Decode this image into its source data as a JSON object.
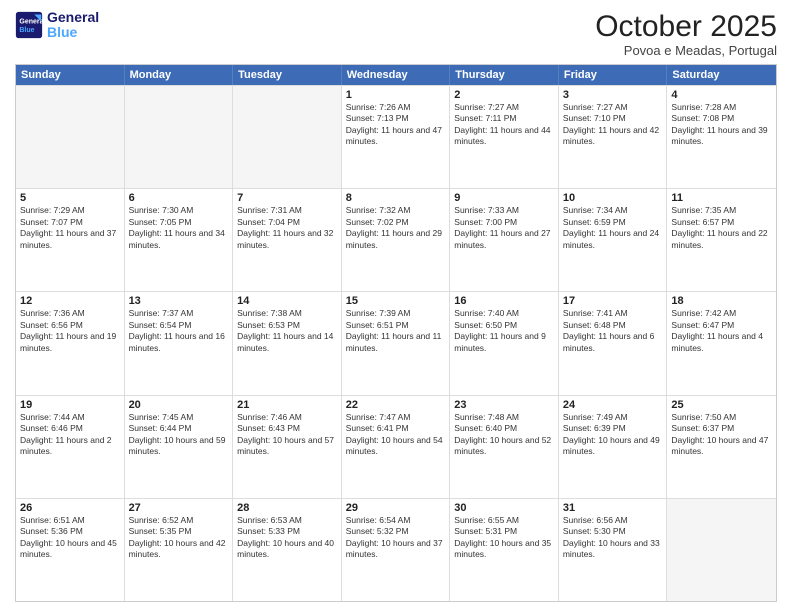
{
  "header": {
    "logo_line1": "General",
    "logo_line2": "Blue",
    "month_title": "October 2025",
    "location": "Povoa e Meadas, Portugal"
  },
  "days_of_week": [
    "Sunday",
    "Monday",
    "Tuesday",
    "Wednesday",
    "Thursday",
    "Friday",
    "Saturday"
  ],
  "rows": [
    [
      {
        "day": "",
        "empty": true
      },
      {
        "day": "",
        "empty": true
      },
      {
        "day": "",
        "empty": true
      },
      {
        "day": "1",
        "sunrise": "7:26 AM",
        "sunset": "7:13 PM",
        "daylight": "11 hours and 47 minutes."
      },
      {
        "day": "2",
        "sunrise": "7:27 AM",
        "sunset": "7:11 PM",
        "daylight": "11 hours and 44 minutes."
      },
      {
        "day": "3",
        "sunrise": "7:27 AM",
        "sunset": "7:10 PM",
        "daylight": "11 hours and 42 minutes."
      },
      {
        "day": "4",
        "sunrise": "7:28 AM",
        "sunset": "7:08 PM",
        "daylight": "11 hours and 39 minutes."
      }
    ],
    [
      {
        "day": "5",
        "sunrise": "7:29 AM",
        "sunset": "7:07 PM",
        "daylight": "11 hours and 37 minutes."
      },
      {
        "day": "6",
        "sunrise": "7:30 AM",
        "sunset": "7:05 PM",
        "daylight": "11 hours and 34 minutes."
      },
      {
        "day": "7",
        "sunrise": "7:31 AM",
        "sunset": "7:04 PM",
        "daylight": "11 hours and 32 minutes."
      },
      {
        "day": "8",
        "sunrise": "7:32 AM",
        "sunset": "7:02 PM",
        "daylight": "11 hours and 29 minutes."
      },
      {
        "day": "9",
        "sunrise": "7:33 AM",
        "sunset": "7:00 PM",
        "daylight": "11 hours and 27 minutes."
      },
      {
        "day": "10",
        "sunrise": "7:34 AM",
        "sunset": "6:59 PM",
        "daylight": "11 hours and 24 minutes."
      },
      {
        "day": "11",
        "sunrise": "7:35 AM",
        "sunset": "6:57 PM",
        "daylight": "11 hours and 22 minutes."
      }
    ],
    [
      {
        "day": "12",
        "sunrise": "7:36 AM",
        "sunset": "6:56 PM",
        "daylight": "11 hours and 19 minutes."
      },
      {
        "day": "13",
        "sunrise": "7:37 AM",
        "sunset": "6:54 PM",
        "daylight": "11 hours and 16 minutes."
      },
      {
        "day": "14",
        "sunrise": "7:38 AM",
        "sunset": "6:53 PM",
        "daylight": "11 hours and 14 minutes."
      },
      {
        "day": "15",
        "sunrise": "7:39 AM",
        "sunset": "6:51 PM",
        "daylight": "11 hours and 11 minutes."
      },
      {
        "day": "16",
        "sunrise": "7:40 AM",
        "sunset": "6:50 PM",
        "daylight": "11 hours and 9 minutes."
      },
      {
        "day": "17",
        "sunrise": "7:41 AM",
        "sunset": "6:48 PM",
        "daylight": "11 hours and 6 minutes."
      },
      {
        "day": "18",
        "sunrise": "7:42 AM",
        "sunset": "6:47 PM",
        "daylight": "11 hours and 4 minutes."
      }
    ],
    [
      {
        "day": "19",
        "sunrise": "7:44 AM",
        "sunset": "6:46 PM",
        "daylight": "11 hours and 2 minutes."
      },
      {
        "day": "20",
        "sunrise": "7:45 AM",
        "sunset": "6:44 PM",
        "daylight": "10 hours and 59 minutes."
      },
      {
        "day": "21",
        "sunrise": "7:46 AM",
        "sunset": "6:43 PM",
        "daylight": "10 hours and 57 minutes."
      },
      {
        "day": "22",
        "sunrise": "7:47 AM",
        "sunset": "6:41 PM",
        "daylight": "10 hours and 54 minutes."
      },
      {
        "day": "23",
        "sunrise": "7:48 AM",
        "sunset": "6:40 PM",
        "daylight": "10 hours and 52 minutes."
      },
      {
        "day": "24",
        "sunrise": "7:49 AM",
        "sunset": "6:39 PM",
        "daylight": "10 hours and 49 minutes."
      },
      {
        "day": "25",
        "sunrise": "7:50 AM",
        "sunset": "6:37 PM",
        "daylight": "10 hours and 47 minutes."
      }
    ],
    [
      {
        "day": "26",
        "sunrise": "6:51 AM",
        "sunset": "5:36 PM",
        "daylight": "10 hours and 45 minutes."
      },
      {
        "day": "27",
        "sunrise": "6:52 AM",
        "sunset": "5:35 PM",
        "daylight": "10 hours and 42 minutes."
      },
      {
        "day": "28",
        "sunrise": "6:53 AM",
        "sunset": "5:33 PM",
        "daylight": "10 hours and 40 minutes."
      },
      {
        "day": "29",
        "sunrise": "6:54 AM",
        "sunset": "5:32 PM",
        "daylight": "10 hours and 37 minutes."
      },
      {
        "day": "30",
        "sunrise": "6:55 AM",
        "sunset": "5:31 PM",
        "daylight": "10 hours and 35 minutes."
      },
      {
        "day": "31",
        "sunrise": "6:56 AM",
        "sunset": "5:30 PM",
        "daylight": "10 hours and 33 minutes."
      },
      {
        "day": "",
        "empty": true
      }
    ]
  ]
}
